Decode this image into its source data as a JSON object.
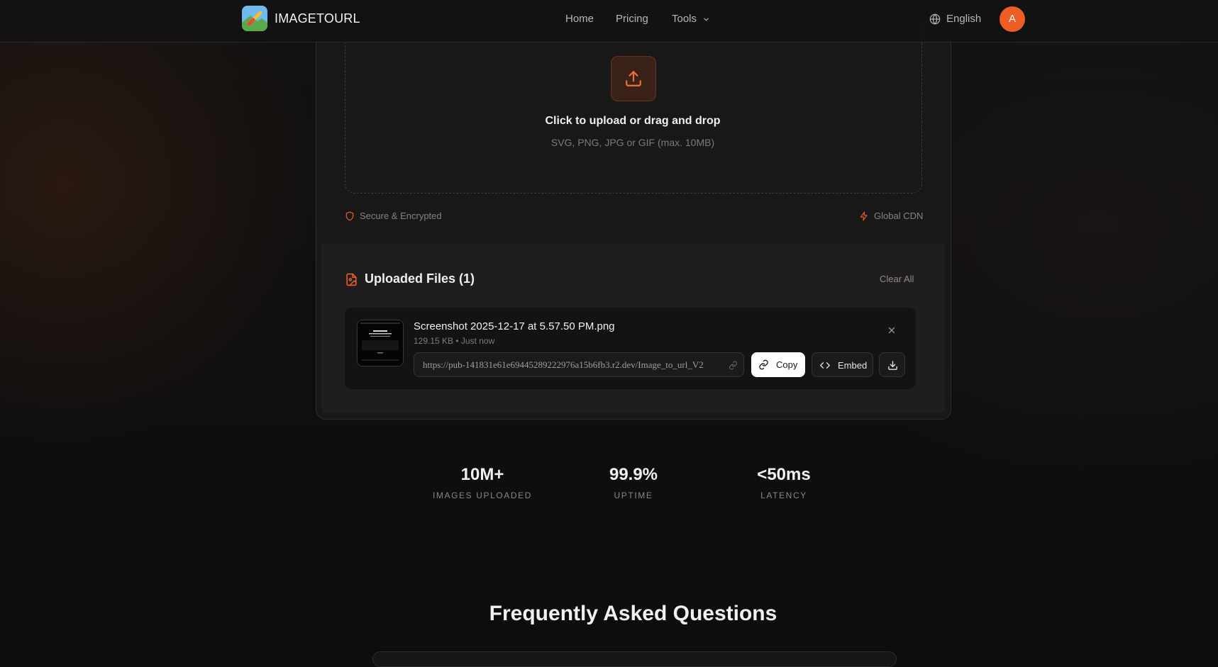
{
  "header": {
    "brand": "IMAGETOURL",
    "nav": [
      "Home",
      "Pricing",
      "Tools"
    ],
    "language": "English",
    "avatar_initial": "A"
  },
  "upload": {
    "title": "Click to upload or drag and drop",
    "subtitle": "SVG, PNG, JPG or GIF (max. 10MB)",
    "secure_label": "Secure & Encrypted",
    "cdn_label": "Global CDN"
  },
  "files": {
    "title": "Uploaded Files (1)",
    "clear_all": "Clear All",
    "items": [
      {
        "name": "Screenshot 2025-12-17 at 5.57.50 PM.png",
        "meta": "129.15 KB • Just now",
        "url": "https://pub-141831e61e69445289222976a15b6fb3.r2.dev/Image_to_url_V2",
        "copy_label": "Copy",
        "embed_label": "Embed"
      }
    ]
  },
  "stats": [
    {
      "value": "10M+",
      "label": "IMAGES UPLOADED"
    },
    {
      "value": "99.9%",
      "label": "UPTIME"
    },
    {
      "value": "<50ms",
      "label": "LATENCY"
    }
  ],
  "faq": {
    "title": "Frequently Asked Questions"
  },
  "colors": {
    "accent": "#ec5e24",
    "background": "#0f0e0e",
    "card": "#191818"
  },
  "icons": [
    "logo-icon",
    "chevron-down-icon",
    "globe-icon",
    "upload-icon",
    "shield-icon",
    "lightning-icon",
    "file-image-icon",
    "close-icon",
    "link-icon",
    "code-icon",
    "download-icon"
  ]
}
